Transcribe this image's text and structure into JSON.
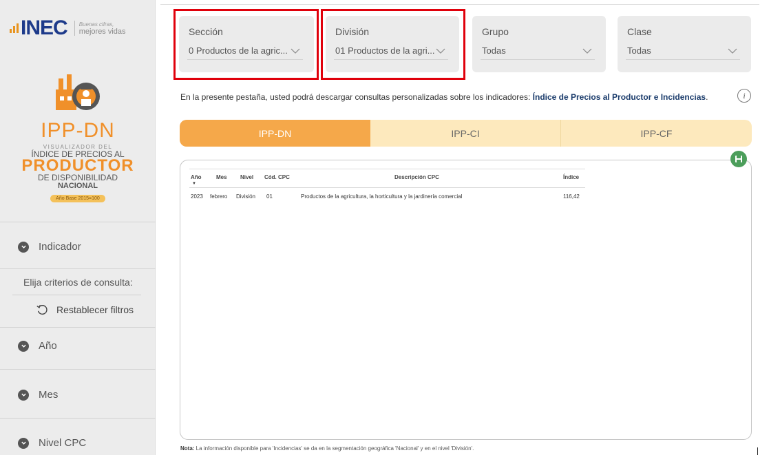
{
  "sidebar": {
    "logo_text": "INEC",
    "slogan_line1": "Buenas cifras,",
    "slogan_line2": "mejores vidas",
    "brand_title": "IPP-DN",
    "brand_line1": "VISUALIZADOR DEL",
    "brand_line2": "ÍNDICE DE PRECIOS AL",
    "brand_line3": "PRODUCTOR",
    "brand_line4": "DE DISPONIBILIDAD",
    "brand_line5": "NACIONAL",
    "brand_base": "Año Base 2015=100",
    "indicador": "Indicador",
    "criteria": "Elija criterios de consulta:",
    "reset": "Restablecer filtros",
    "anio": "Año",
    "mes": "Mes",
    "nivel": "Nivel CPC"
  },
  "filters": {
    "seccion": {
      "label": "Sección",
      "value": "0 Productos de la agric..."
    },
    "division": {
      "label": "División",
      "value": "01 Productos de la agri..."
    },
    "grupo": {
      "label": "Grupo",
      "value": "Todas"
    },
    "clase": {
      "label": "Clase",
      "value": "Todas"
    }
  },
  "intro": {
    "text": "En la presente pestaña, usted podrá descargar consultas personalizadas sobre los indicadores: ",
    "bold": "Índice de Precios al Productor e Incidencias",
    "end": "."
  },
  "info_icon": "i",
  "tabs": [
    "IPP-DN",
    "IPP-CI",
    "IPP-CF"
  ],
  "table": {
    "headers": [
      "Año",
      "Mes",
      "Nivel",
      "Cód. CPC",
      "Descripción CPC",
      "Índice"
    ],
    "rows": [
      [
        "2023",
        "febrero",
        "División",
        "01",
        "Productos de la agricultura, la horticultura y la jardinería comercial",
        "116,42"
      ]
    ]
  },
  "nota": {
    "label": "Nota:",
    "text": " La información disponible para 'Incidencias' se da en la segmentación geográfica 'Nacional' y en el nivel 'División'."
  },
  "colors": {
    "accent_orange": "#f5a84a",
    "tab_inactive": "#fde9bd",
    "highlight_red": "#e0000b",
    "save_green": "#4c9e5b"
  }
}
